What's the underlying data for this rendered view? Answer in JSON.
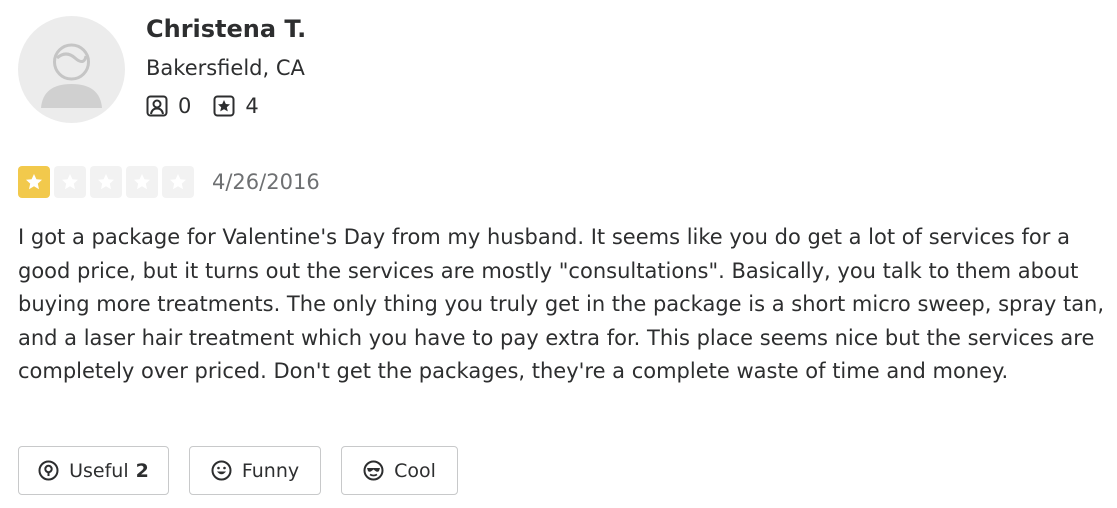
{
  "user": {
    "name": "Christena T.",
    "location": "Bakersfield, CA",
    "friends_count": "0",
    "reviews_count": "4",
    "avatar_icon": "default-user-avatar"
  },
  "review": {
    "rating": 1,
    "rating_max": 5,
    "date": "4/26/2016",
    "text": "I got a package for Valentine's Day from my husband. It seems like you do get a lot of services for a good price, but it turns out the services are mostly \"consultations\". Basically, you talk to them about buying more treatments. The only thing you truly get in the package is a short micro sweep, spray tan, and a laser hair treatment which you have to pay extra for. This place seems nice but the services are completely over priced. Don't get the packages, they're a complete waste of time and money."
  },
  "actions": {
    "useful_label": "Useful",
    "useful_count": "2",
    "funny_label": "Funny",
    "cool_label": "Cool"
  },
  "colors": {
    "star_filled": "#f2c94c",
    "star_empty": "#f2f2f2",
    "text": "#2d2e2f",
    "muted": "#6e7072"
  }
}
